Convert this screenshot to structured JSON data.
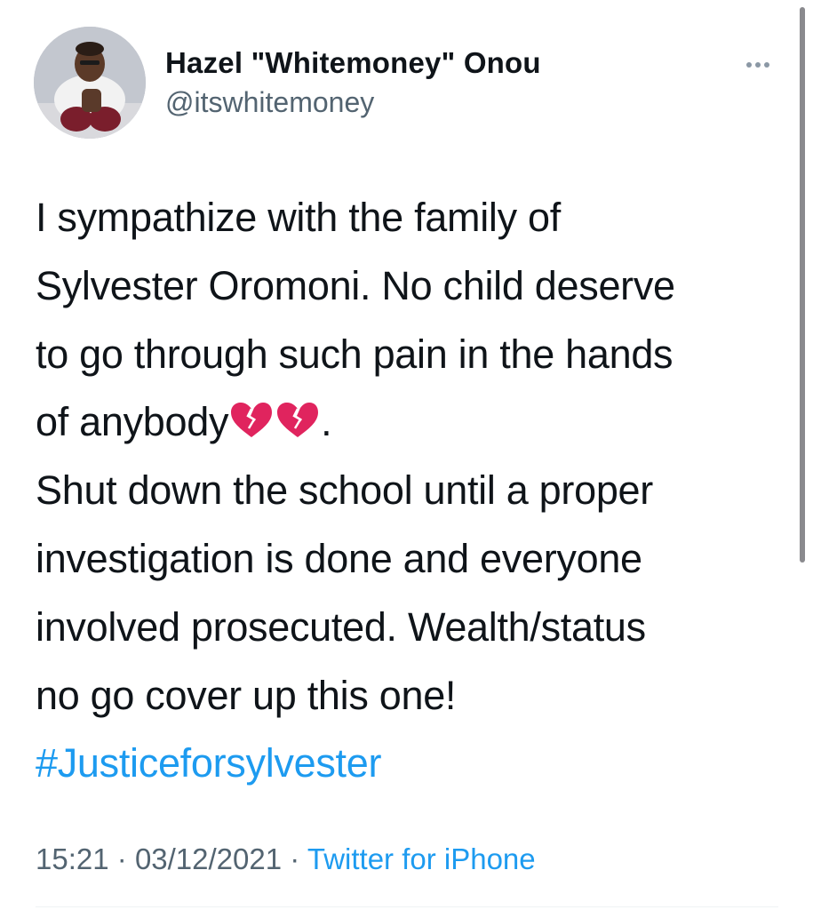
{
  "tweet": {
    "author": {
      "display_name": "Hazel \"Whitemoney\" Onou",
      "handle": "@itswhitemoney",
      "avatar_icon": "profile-photo"
    },
    "more_icon": "ellipsis-icon",
    "text_lines": [
      "I sympathize with the family of",
      "Sylvester Oromoni. No child deserve",
      "to go through such pain in the hands",
      "of anybody",
      "Shut down the school until a proper",
      "investigation is done and everyone",
      "involved prosecuted. Wealth/status",
      "no go cover up this one!"
    ],
    "line4_suffix": ".",
    "emoji_name": "broken-heart-icon",
    "emoji_count": 2,
    "hashtag": "#Justiceforsylvester",
    "time": "15:21",
    "separator": "·",
    "date": "03/12/2021",
    "source": "Twitter for iPhone"
  },
  "colors": {
    "text": "#0f1419",
    "secondary": "#536471",
    "link": "#1d9bf0",
    "emoji_red": "#e0245e",
    "scrollbar": "#8a8a8e"
  }
}
